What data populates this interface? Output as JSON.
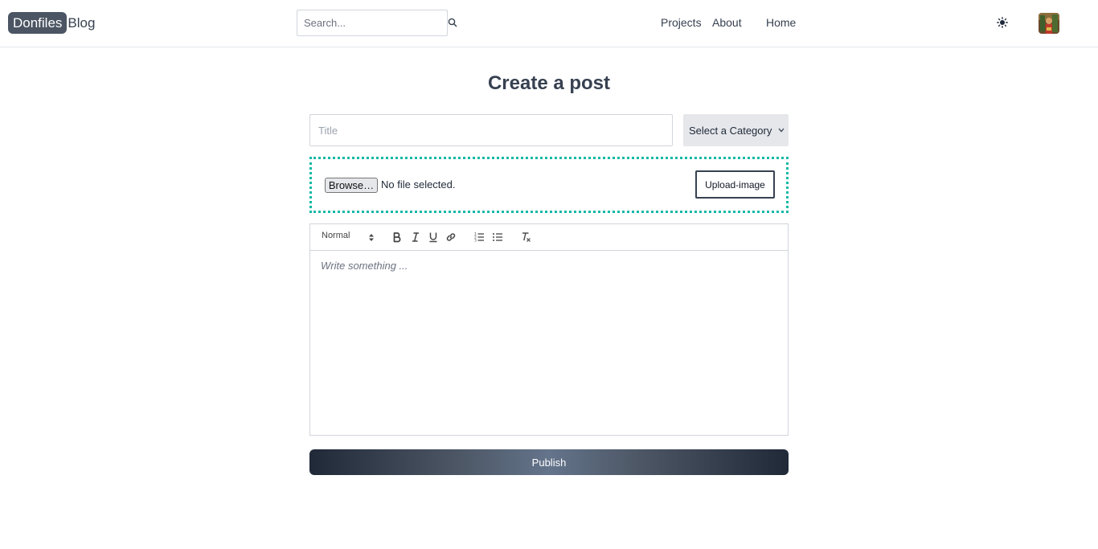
{
  "header": {
    "logo_highlight": "Donfiles",
    "logo_rest": "Blog",
    "search_placeholder": "Search...",
    "nav": [
      {
        "label": "Projects"
      },
      {
        "label": "About"
      },
      {
        "label": "Home"
      }
    ]
  },
  "main": {
    "page_title": "Create a post",
    "title_placeholder": "Title",
    "category_label": "Select a Category",
    "browse_label": "Browse…",
    "file_status": "No file selected.",
    "upload_label": "Upload-image",
    "editor": {
      "heading_value": "Normal",
      "placeholder": "Write something ..."
    },
    "publish_label": "Publish"
  },
  "colors": {
    "accent_dashed_border": "#14b8a6",
    "logo_pill": "#4b5563",
    "publish_gradient_dark": "#1f2937",
    "publish_gradient_light": "#64748b"
  },
  "icons": [
    "search-icon",
    "theme-toggle-icon",
    "bold-icon",
    "italic-icon",
    "underline-icon",
    "link-icon",
    "ordered-list-icon",
    "bullet-list-icon",
    "clear-format-icon",
    "chevron-down-icon"
  ]
}
